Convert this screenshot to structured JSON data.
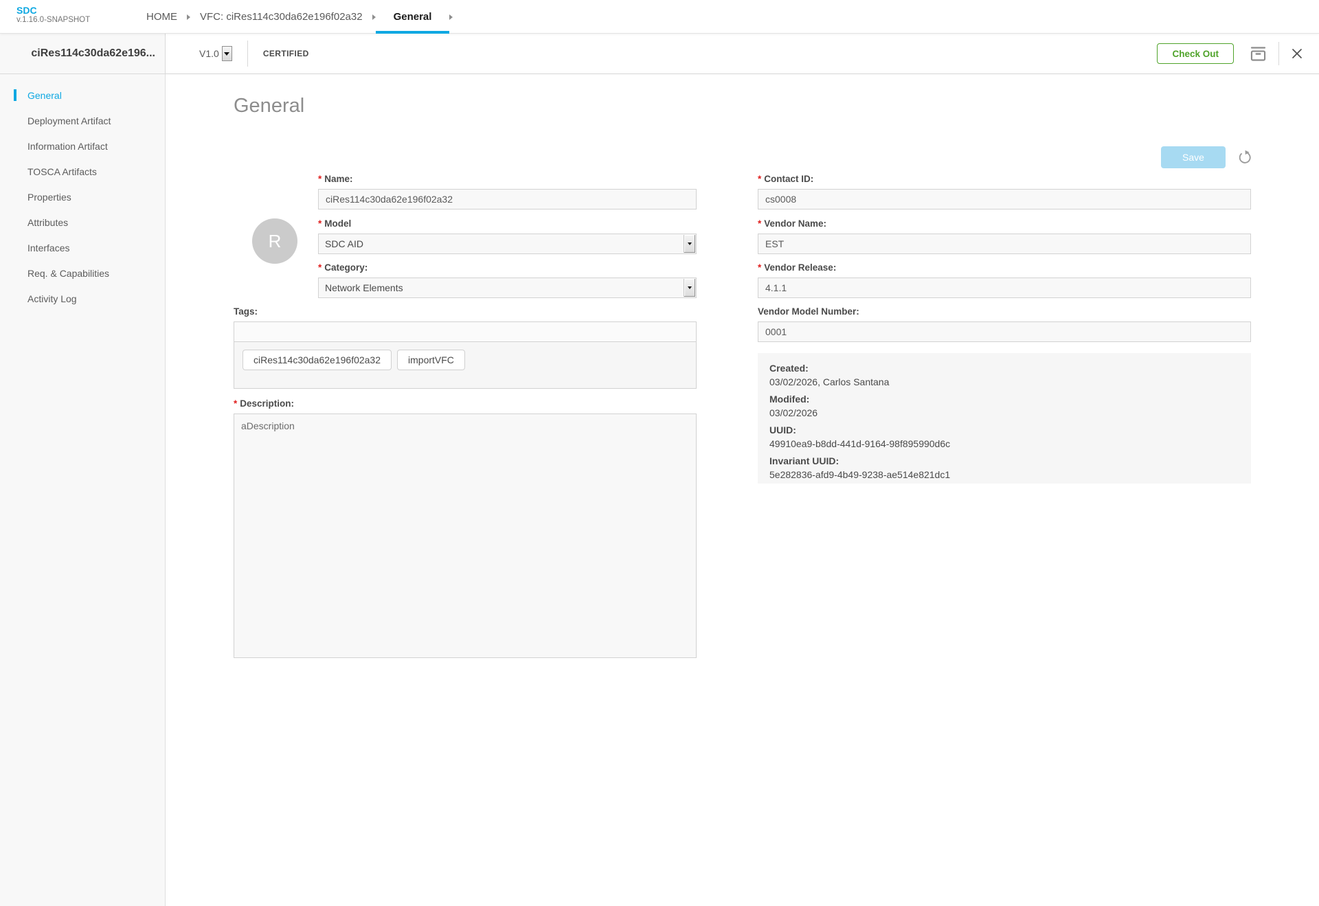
{
  "colors": {
    "accent": "#0da8e2",
    "green": "#4fa32a",
    "save_disabled": "#a7daf2",
    "required": "#e0201f"
  },
  "app": {
    "name": "SDC",
    "version": "v.1.16.0-SNAPSHOT"
  },
  "breadcrumb": {
    "home": "HOME",
    "vfc": "VFC: ciRes114c30da62e196f02a32",
    "general": "General"
  },
  "header": {
    "title": "ciRes114c30da62e196...",
    "version_selected": "V1.0",
    "lifecycle_state": "CERTIFIED",
    "checkout": "Check Out"
  },
  "sidebar": {
    "items": [
      "General",
      "Deployment Artifact",
      "Information Artifact",
      "TOSCA Artifacts",
      "Properties",
      "Attributes",
      "Interfaces",
      "Req. & Capabilities",
      "Activity Log"
    ]
  },
  "general": {
    "page_title": "General",
    "save": "Save",
    "required_marker": "*",
    "avatar_letter": "R",
    "name": {
      "label": "Name:",
      "value": "ciRes114c30da62e196f02a32"
    },
    "model": {
      "label": "Model",
      "value": "SDC AID"
    },
    "category": {
      "label": "Category:",
      "value": "Network Elements"
    },
    "contact_id": {
      "label": "Contact ID:",
      "value": "cs0008"
    },
    "vendor_name": {
      "label": "Vendor Name:",
      "value": "EST"
    },
    "vendor_release": {
      "label": "Vendor Release:",
      "value": "4.1.1"
    },
    "vendor_model_number": {
      "label": "Vendor Model Number:",
      "value": "0001"
    },
    "tags": {
      "label": "Tags:",
      "input_value": "",
      "items": [
        "ciRes114c30da62e196f02a32",
        "importVFC"
      ]
    },
    "description": {
      "label": "Description:",
      "value": "aDescription"
    },
    "meta": {
      "created_label": "Created:",
      "created_value": "03/02/2026, Carlos Santana",
      "modified_label": "Modifed:",
      "modified_value": "03/02/2026",
      "uuid_label": "UUID:",
      "uuid_value": "49910ea9-b8dd-441d-9164-98f895990d6c",
      "invariant_label": "Invariant UUID:",
      "invariant_value": "5e282836-afd9-4b49-9238-ae514e821dc1"
    }
  }
}
